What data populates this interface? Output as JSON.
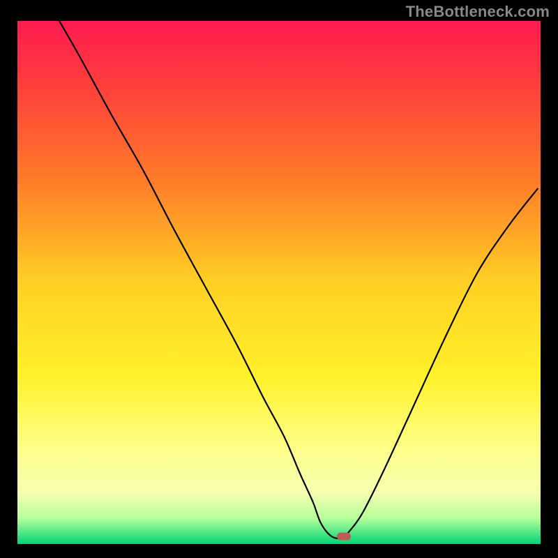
{
  "attribution": "TheBottleneck.com",
  "chart_data": {
    "type": "line",
    "title": "",
    "xlabel": "",
    "ylabel": "",
    "xlim": [
      0,
      100
    ],
    "ylim": [
      0,
      100
    ],
    "gradient_stops": [
      {
        "offset": 0,
        "color": "#ff1a4f"
      },
      {
        "offset": 12,
        "color": "#ff3e3d"
      },
      {
        "offset": 30,
        "color": "#ff7a29"
      },
      {
        "offset": 50,
        "color": "#ffd024"
      },
      {
        "offset": 68,
        "color": "#fff12a"
      },
      {
        "offset": 82,
        "color": "#ffff8a"
      },
      {
        "offset": 90,
        "color": "#f5ffb0"
      },
      {
        "offset": 95,
        "color": "#b8ff9a"
      },
      {
        "offset": 100,
        "color": "#00d477"
      }
    ],
    "series": [
      {
        "name": "bottleneck-curve",
        "x": [
          8,
          12,
          18,
          24,
          30,
          36,
          42,
          47,
          51,
          54,
          56.5,
          58,
          60,
          62,
          63.5,
          66,
          70,
          76,
          82,
          88,
          94,
          99.5
        ],
        "y": [
          100,
          93,
          82,
          71.5,
          60,
          49,
          38,
          28,
          20.5,
          13.5,
          8,
          4,
          1.5,
          1.2,
          2.5,
          6,
          14,
          27,
          40,
          52,
          61,
          68
        ]
      }
    ],
    "marker": {
      "x": 62.4,
      "y": 1.5
    }
  }
}
